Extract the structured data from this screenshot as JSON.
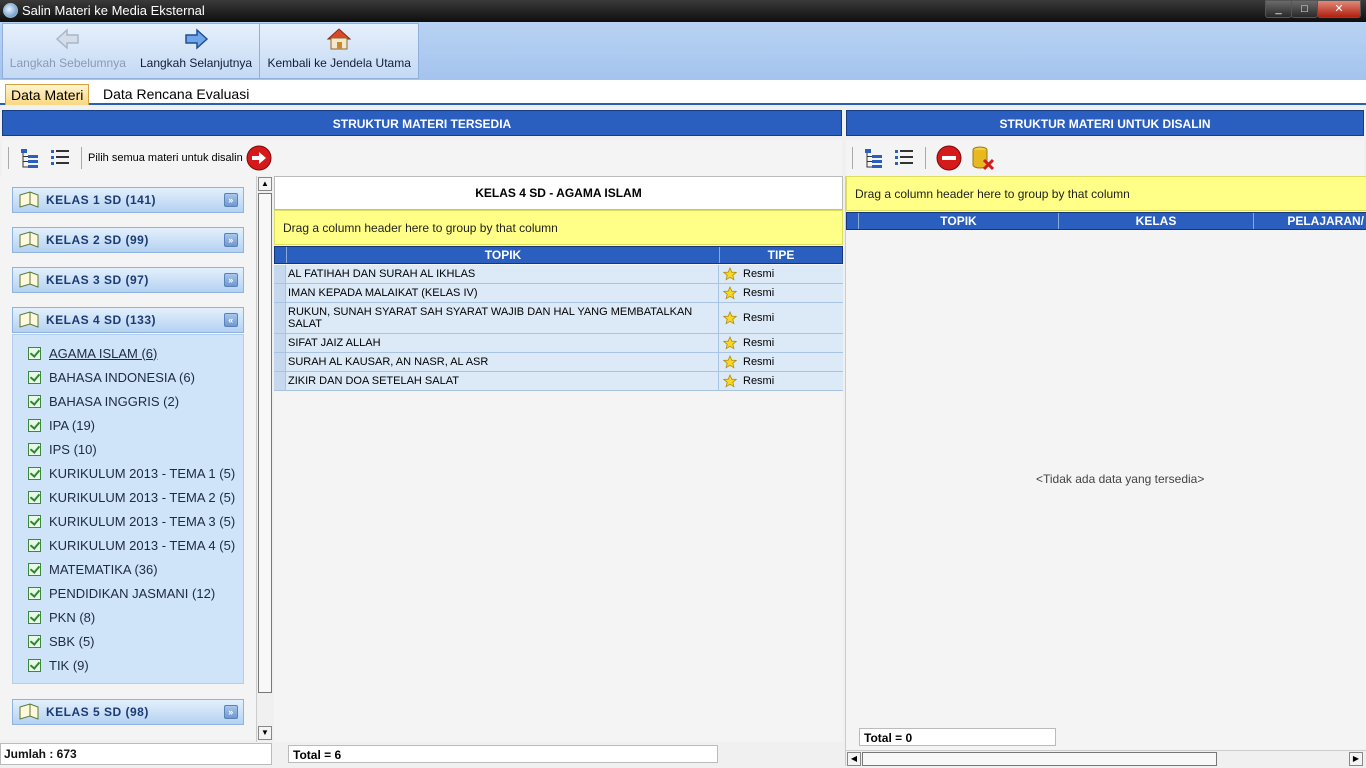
{
  "window": {
    "title": "Salin Materi ke Media Eksternal",
    "min": "_",
    "max": "□",
    "close": "✕"
  },
  "toolbar": {
    "prev_label": "Langkah Sebelumnya",
    "next_label": "Langkah Selanjutnya",
    "home_label": "Kembali ke Jendela Utama"
  },
  "tabs": [
    "Data Materi",
    "Data Rencana Evaluasi"
  ],
  "left_panel": {
    "header": "STRUKTUR MATERI TERSEDIA",
    "select_all_label": "Pilih semua materi untuk disalin",
    "groups": [
      "KELAS 1 SD (141)",
      "KELAS 2 SD (99)",
      "KELAS 3 SD (97)",
      "KELAS 4 SD (133)",
      "KELAS 5 SD (98)"
    ],
    "kelas4_items": [
      "AGAMA ISLAM (6)",
      "BAHASA INDONESIA (6)",
      "BAHASA INGGRIS (2)",
      "IPA (19)",
      "IPS (10)",
      "KURIKULUM 2013 - TEMA 1 (5)",
      "KURIKULUM 2013 - TEMA 2 (5)",
      "KURIKULUM 2013 - TEMA 3 (5)",
      "KURIKULUM 2013 - TEMA 4 (5)",
      "MATEMATIKA (36)",
      "PENDIDIKAN JASMANI (12)",
      "PKN (8)",
      "SBK (5)",
      "TIK (9)"
    ],
    "jumlah": "Jumlah : 673"
  },
  "middle_grid": {
    "title": "KELAS 4 SD - AGAMA ISLAM",
    "group_hint": "Drag a column header here to group by that column",
    "columns": [
      "TOPIK",
      "TIPE"
    ],
    "rows": [
      {
        "topik": "AL FATIHAH DAN SURAH AL IKHLAS",
        "tipe": "Resmi"
      },
      {
        "topik": "IMAN KEPADA MALAIKAT (KELAS IV)",
        "tipe": "Resmi"
      },
      {
        "topik": "RUKUN, SUNAH SYARAT SAH SYARAT WAJIB DAN HAL YANG MEMBATALKAN SALAT",
        "tipe": "Resmi"
      },
      {
        "topik": "SIFAT JAIZ ALLAH",
        "tipe": "Resmi"
      },
      {
        "topik": "SURAH AL KAUSAR, AN NASR, AL ASR",
        "tipe": "Resmi"
      },
      {
        "topik": "ZIKIR DAN DOA SETELAH SALAT",
        "tipe": "Resmi"
      }
    ],
    "total": "Total = 6"
  },
  "right_panel": {
    "header": "STRUKTUR MATERI UNTUK DISALIN",
    "group_hint": "Drag a column header here to group by that column",
    "columns": [
      "TOPIK",
      "KELAS",
      "PELAJARAN/"
    ],
    "empty_text": "<Tidak ada data yang tersedia>",
    "total": "Total = 0"
  },
  "colors": {
    "header_blue": "#2a5fbf",
    "group_yellow": "#ffff88",
    "row_blue": "#dce9f7"
  }
}
